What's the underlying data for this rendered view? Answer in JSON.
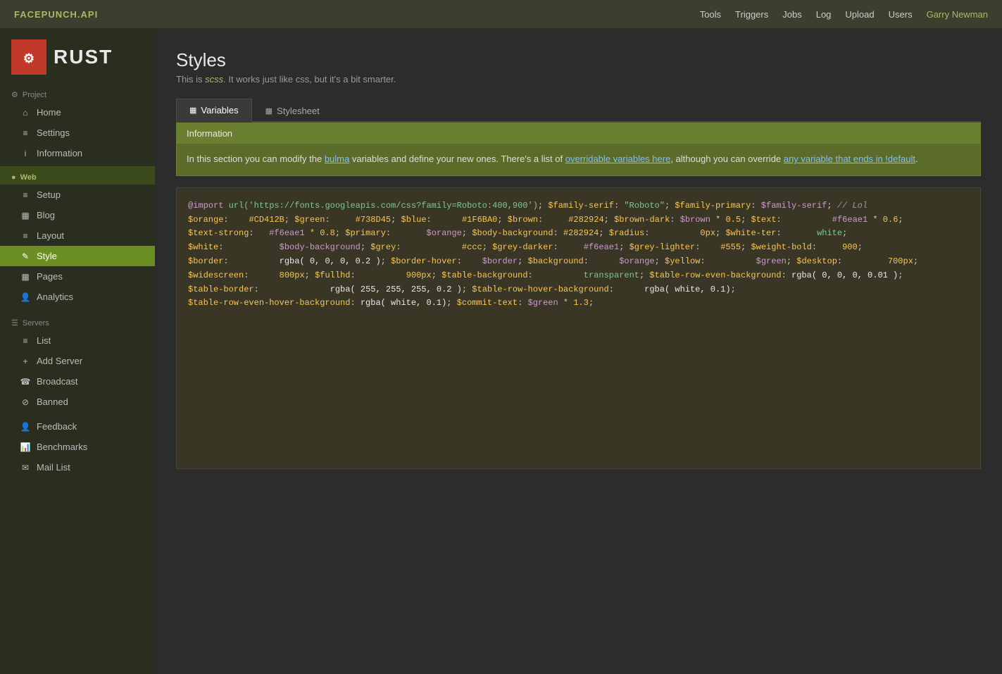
{
  "topnav": {
    "brand": "FACEPUNCH.API",
    "links": [
      "Tools",
      "Triggers",
      "Jobs",
      "Log",
      "Upload",
      "Users"
    ],
    "user": "Garry Newman"
  },
  "sidebar": {
    "logo_text": "RUST",
    "sections": [
      {
        "type": "group",
        "label": "Project",
        "icon": "⚙",
        "items": [
          {
            "label": "Home",
            "icon": "⌂",
            "active": false
          },
          {
            "label": "Settings",
            "icon": "≡",
            "active": false
          },
          {
            "label": "Information",
            "icon": "i",
            "active": false
          }
        ]
      },
      {
        "type": "group",
        "label": "Web",
        "icon": "🌐",
        "active": true,
        "items": [
          {
            "label": "Setup",
            "icon": "≡",
            "active": false
          },
          {
            "label": "Blog",
            "icon": "▦",
            "active": false
          },
          {
            "label": "Layout",
            "icon": "≡",
            "active": false
          },
          {
            "label": "Style",
            "icon": "✎",
            "active": true
          },
          {
            "label": "Pages",
            "icon": "▦",
            "active": false
          },
          {
            "label": "Analytics",
            "icon": "👤",
            "active": false
          }
        ]
      },
      {
        "type": "group",
        "label": "Servers",
        "icon": "☰",
        "items": [
          {
            "label": "List",
            "icon": "≡",
            "active": false
          },
          {
            "label": "Add Server",
            "icon": "+",
            "active": false
          },
          {
            "label": "Broadcast",
            "icon": "☎",
            "active": false
          },
          {
            "label": "Banned",
            "icon": "⊘",
            "active": false
          }
        ]
      },
      {
        "type": "standalone",
        "items": [
          {
            "label": "Feedback",
            "icon": "👤",
            "active": false
          },
          {
            "label": "Benchmarks",
            "icon": "📊",
            "active": false
          },
          {
            "label": "Mail List",
            "icon": "✉",
            "active": false
          }
        ]
      }
    ]
  },
  "page": {
    "title": "Styles",
    "subtitle_prefix": "This is ",
    "subtitle_highlight": "scss",
    "subtitle_suffix": ". It works just like css, but it's a bit smarter.",
    "tabs": [
      {
        "label": "Variables",
        "icon": "▦",
        "active": true
      },
      {
        "label": "Stylesheet",
        "icon": "▦",
        "active": false
      }
    ],
    "info": {
      "header": "Information",
      "body_prefix": "In this section you can modify the ",
      "link1_text": "bulma",
      "link1_url": "#",
      "body_middle": " variables and define your new ones. There's a list of ",
      "link2_text": "overridable variables here",
      "link2_url": "#",
      "body_end_prefix": ", although you can override ",
      "link3_text": "any variable that ends in !default",
      "link3_url": "#",
      "body_end": "."
    }
  }
}
